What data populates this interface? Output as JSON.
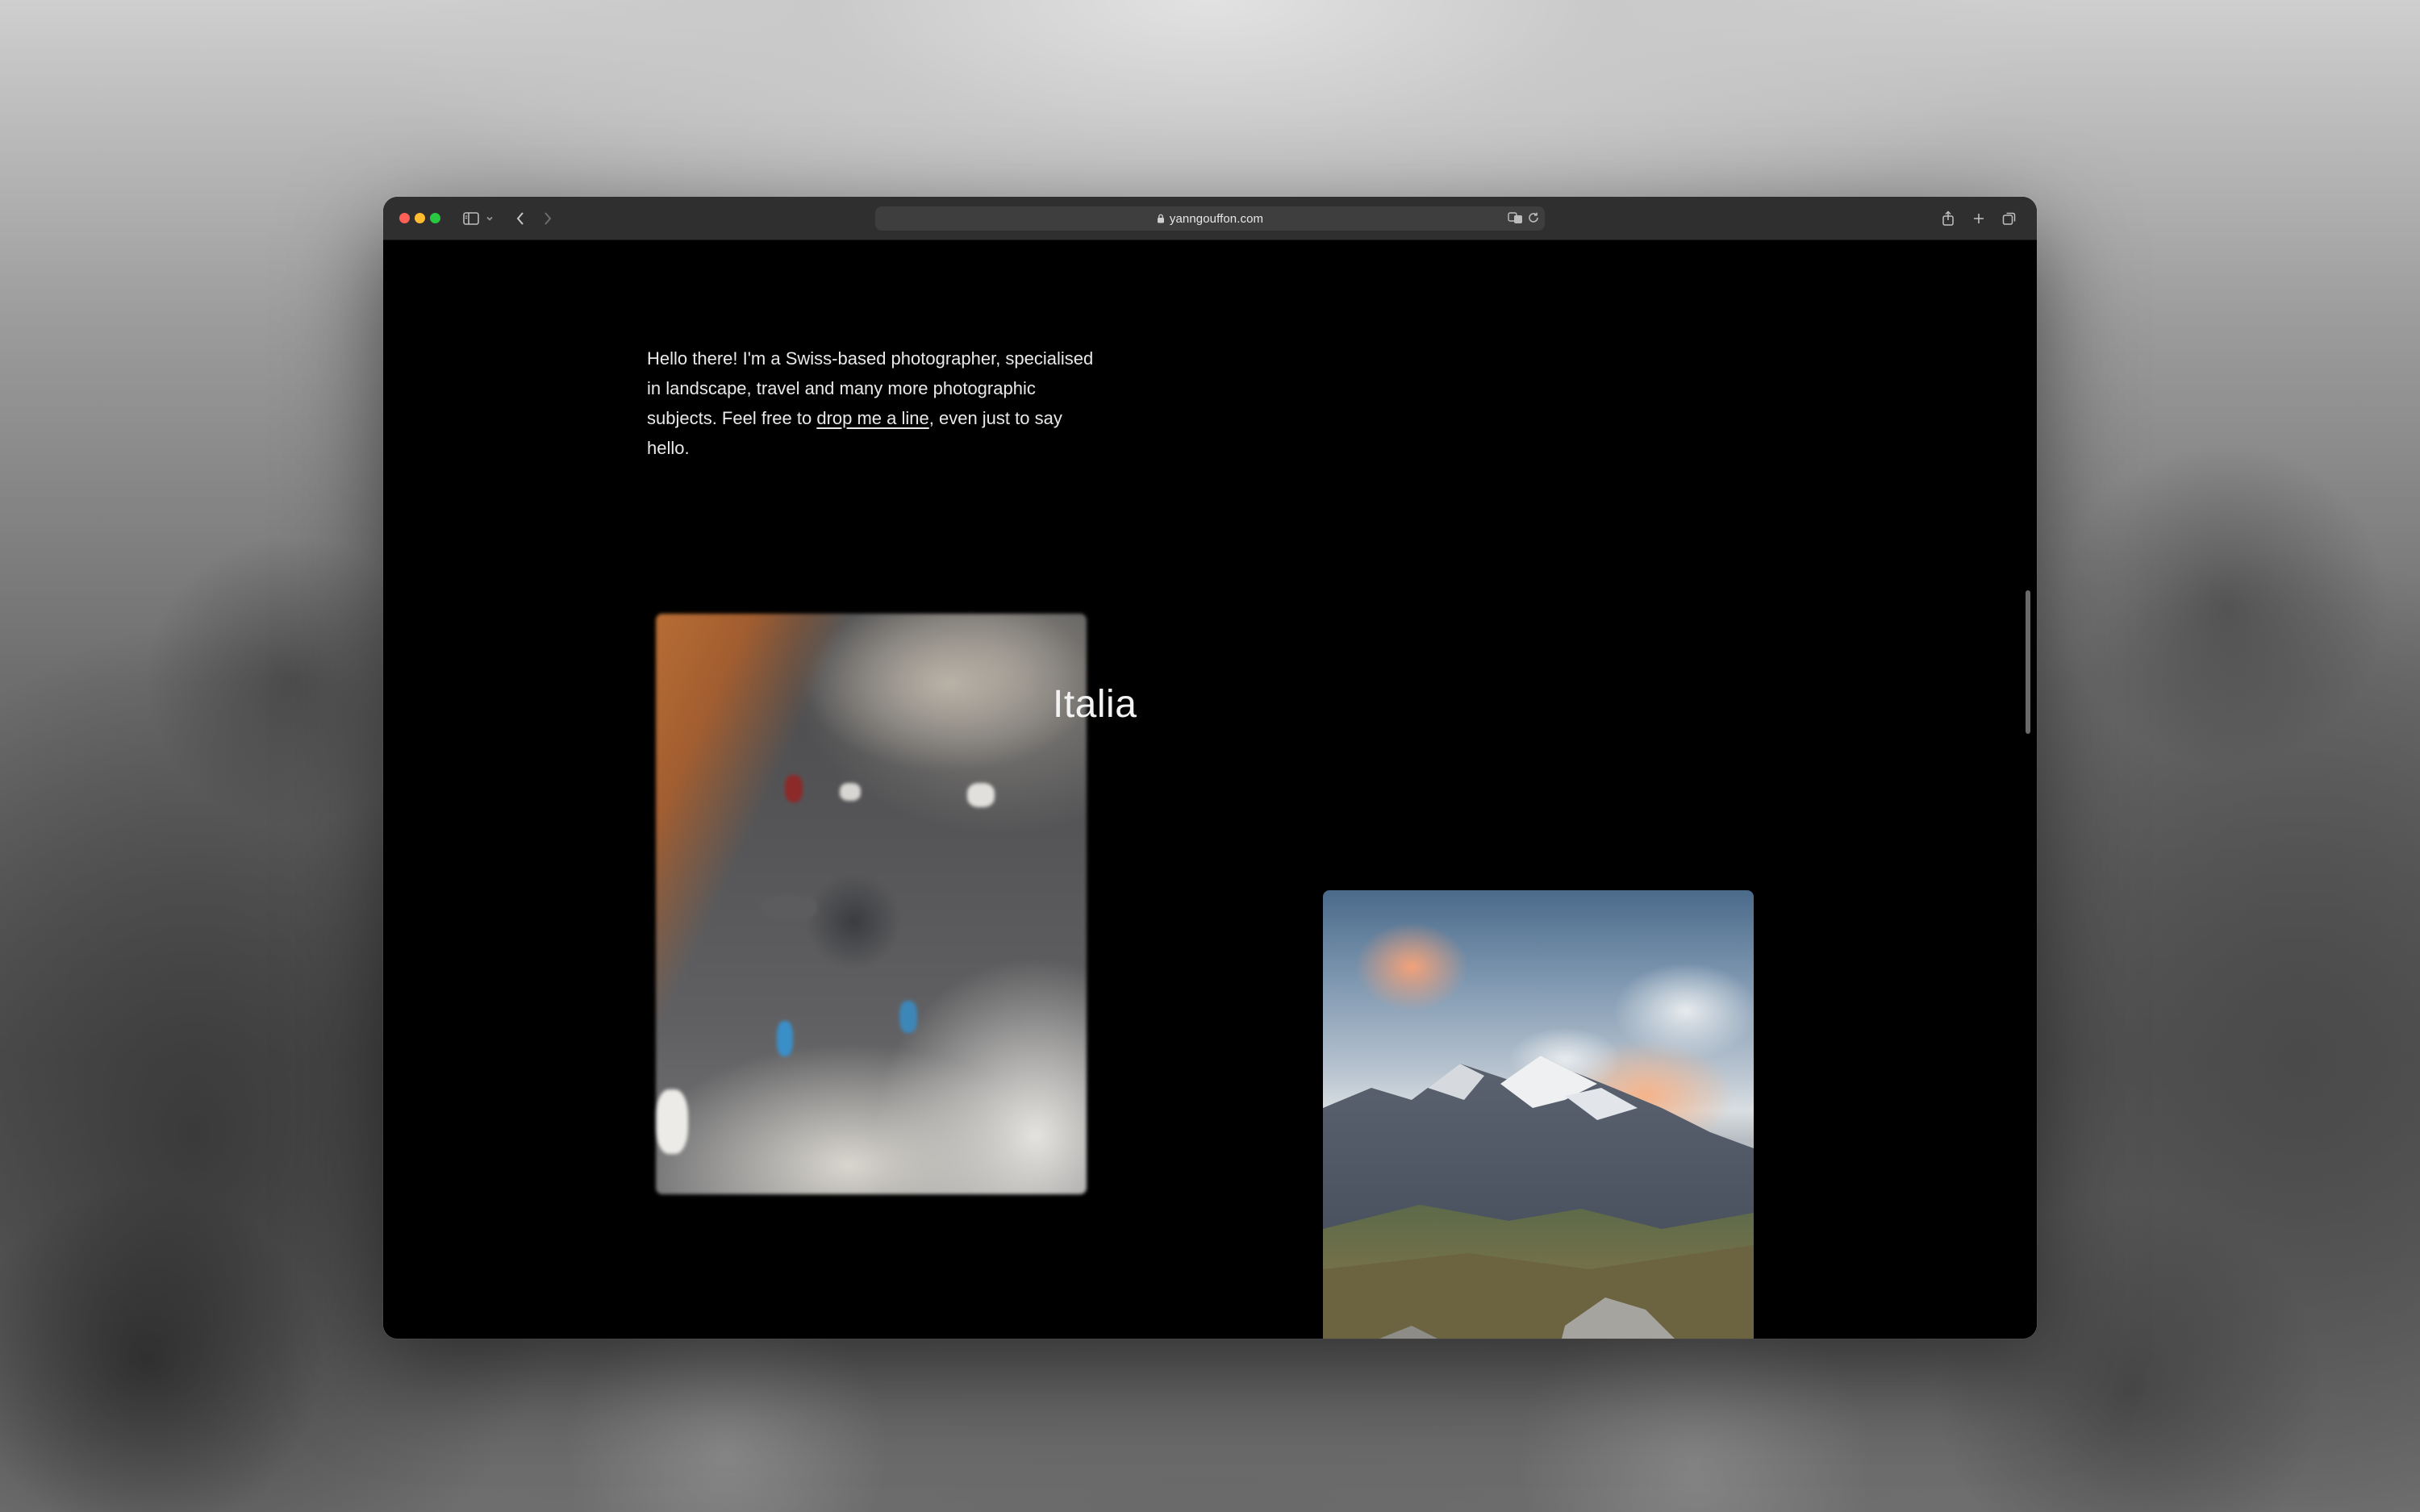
{
  "browser": {
    "url": "yanngouffon.com",
    "icons": [
      "sidebar-icon",
      "chevron-down-icon",
      "back-icon",
      "forward-icon",
      "lock-icon",
      "translate-icon",
      "reload-icon",
      "share-icon",
      "new-tab-icon",
      "tab-overview-icon"
    ]
  },
  "page": {
    "intro_before": "Hello there! I'm a Swiss-based photographer, specialised in landscape, travel and many more photographic subjects. Feel free to ",
    "intro_link": "drop me a line",
    "intro_after": ", even just to say hello.",
    "section_title": "Italia"
  },
  "colors": {
    "page_background": "#000000",
    "toolbar": "#2f2f2f",
    "text": "#e9e9e9"
  }
}
